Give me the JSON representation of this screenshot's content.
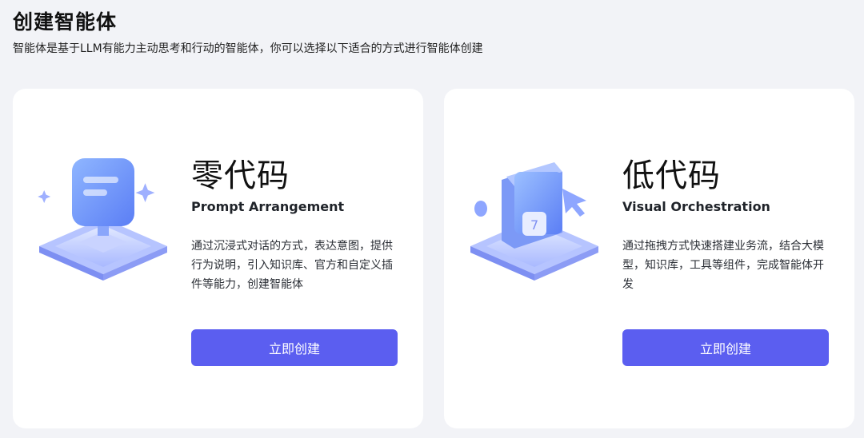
{
  "header": {
    "title": "创建智能体",
    "subtitle": "智能体是基于LLM有能力主动思考和行动的智能体，你可以选择以下适合的方式进行智能体创建"
  },
  "cards": [
    {
      "title": "零代码",
      "subtitle": "Prompt Arrangement",
      "description": "通过沉浸式对话的方式，表达意图，提供行为说明，引入知识库、官方和自定义插件等能力，创建智能体",
      "button_label": "立即创建",
      "illustration_icon": "chat-bubble-icon"
    },
    {
      "title": "低代码",
      "subtitle": "Visual Orchestration",
      "description": "通过拖拽方式快速搭建业务流，结合大模型，知识库，工具等组件，完成智能体开发",
      "button_label": "立即创建",
      "illustration_icon": "drag-cursor-icon"
    }
  ],
  "colors": {
    "background": "#f2f3f7",
    "card": "#ffffff",
    "accent": "#5b5ef0"
  }
}
